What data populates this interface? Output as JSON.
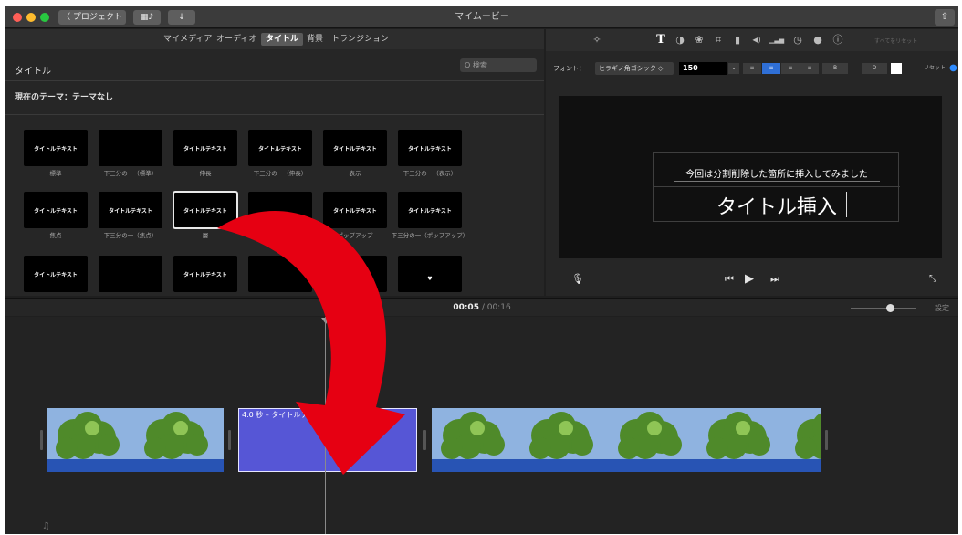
{
  "window": {
    "title": "マイムービー",
    "back_button": "〈 プロジェクト",
    "share_icon": "share-icon"
  },
  "browser": {
    "tabs": [
      "マイメディア",
      "オーディオ",
      "タイトル",
      "背景",
      "トランジション"
    ],
    "active_tab": "タイトル",
    "section_label": "タイトル",
    "search_placeholder": "Q 検索",
    "theme_label": "現在のテーマ：テーマなし",
    "tiles": [
      {
        "title": "タイトルテキスト",
        "label": "標準"
      },
      {
        "title": "",
        "label": "下三分の一（標準）"
      },
      {
        "title": "タイトルテキスト",
        "label": "伸長"
      },
      {
        "title": "タイトルテキスト",
        "label": "下三分の一（伸長）"
      },
      {
        "title": "タイトルテキスト",
        "label": "表示"
      },
      {
        "title": "タイトルテキスト",
        "label": "下三分の一（表示）"
      },
      {
        "title": "タイトルテキスト",
        "label": "焦点"
      },
      {
        "title": "タイトルテキスト",
        "label": "下三分の一（焦点）"
      },
      {
        "title": "タイトルテキスト",
        "label": "層"
      },
      {
        "title": "",
        "label": ""
      },
      {
        "title": "タイトルテキスト",
        "label": "ポップアップ"
      },
      {
        "title": "タイトルテキスト",
        "label": "下三分の一（ポップアップ）"
      },
      {
        "title": "タイトルテキスト",
        "label": ""
      },
      {
        "title": "",
        "label": ""
      },
      {
        "title": "タイトルテキスト",
        "label": ""
      },
      {
        "title": "",
        "label": ""
      },
      {
        "title": "",
        "label": ""
      },
      {
        "title": "♥",
        "label": ""
      }
    ],
    "selected_tile_index": 8
  },
  "inspector": {
    "tools": [
      "magic-wand-icon",
      "text-icon",
      "color-balance-icon",
      "color-correction-icon",
      "crop-icon",
      "camera-icon",
      "volume-icon",
      "equalizer-icon",
      "speed-icon",
      "filter-icon",
      "info-icon"
    ],
    "reset_all": "すべてをリセット",
    "font_label": "フォント：",
    "font_name": "ヒラギノ角ゴシック",
    "font_size": "150",
    "bold": "B",
    "outline": "O",
    "reset": "リセット",
    "subtitle_text": "今回は分割削除した箇所に挿入してみました",
    "main_title_text": "タイトル挿入"
  },
  "timeline": {
    "current_time": "00:05",
    "total_time": "00:16",
    "separator": " / ",
    "settings_label": "設定",
    "zoom_level": 0.6,
    "title_clip_label": "4.0 秒 – タイトルテキスト"
  },
  "colors": {
    "title_clip": "#5656d6",
    "video_band": "#2854b4",
    "arrow": "#e60012"
  }
}
